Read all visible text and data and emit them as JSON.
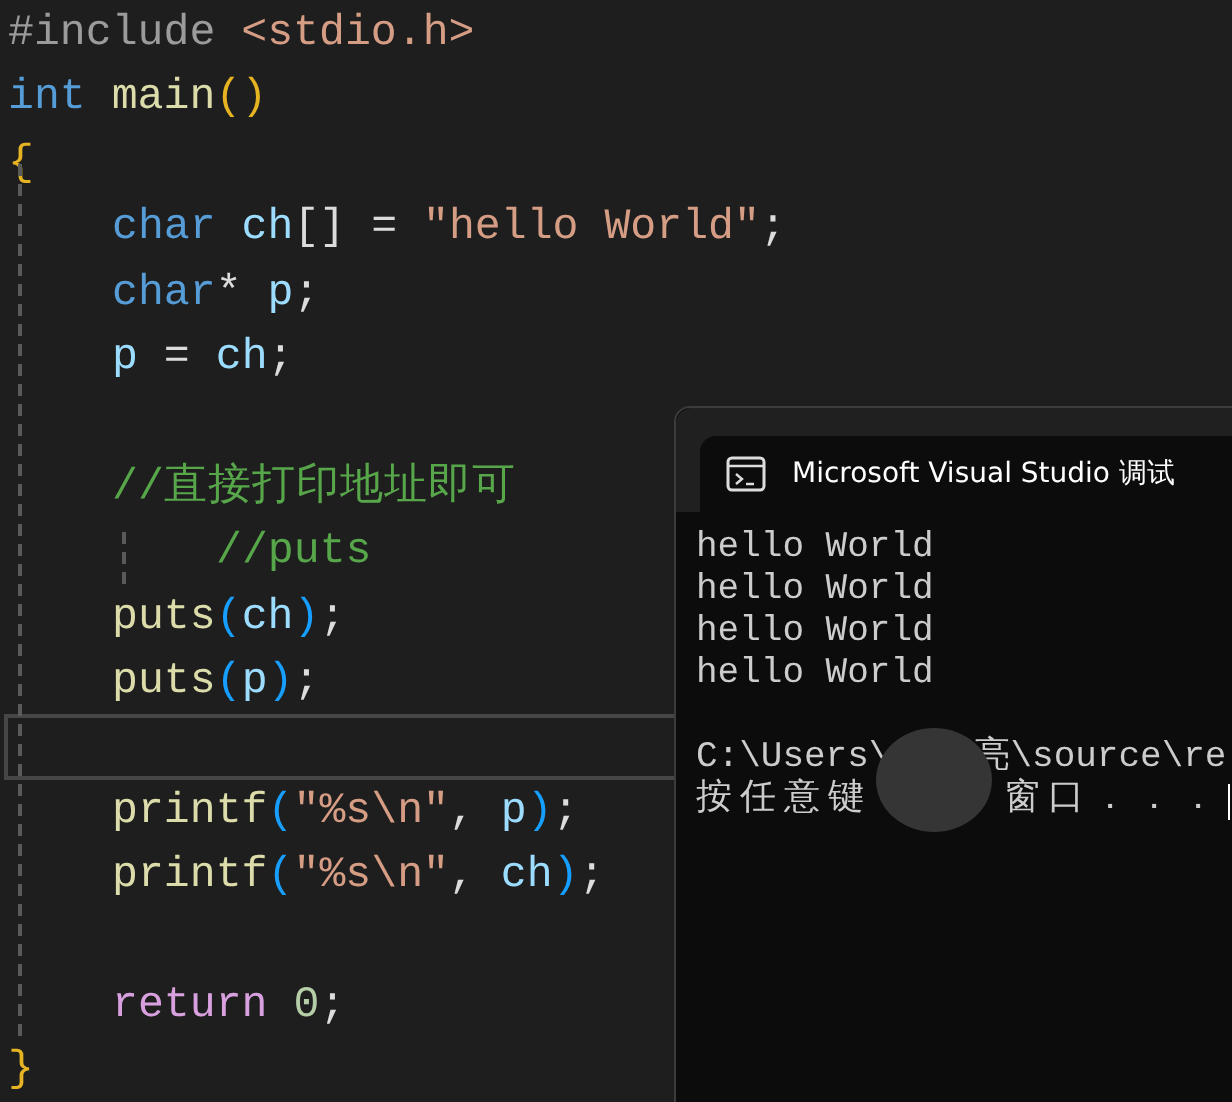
{
  "editor": {
    "lines": [
      {
        "current": false,
        "tokens": [
          {
            "kind": "preproc",
            "text": "#include "
          },
          {
            "kind": "include",
            "text": "<stdio.h>"
          }
        ]
      },
      {
        "current": false,
        "tokens": [
          {
            "kind": "keyword",
            "text": "int "
          },
          {
            "kind": "func",
            "text": "main"
          },
          {
            "kind": "brace",
            "text": "()"
          }
        ]
      },
      {
        "current": false,
        "tokens": [
          {
            "kind": "brace",
            "text": "{"
          }
        ],
        "children": [
          {
            "current": false,
            "tokens": [
              {
                "kind": "keyword",
                "text": "char "
              },
              {
                "kind": "var",
                "text": "ch"
              },
              {
                "kind": "plain",
                "text": "[] = "
              },
              {
                "kind": "string",
                "text": "\"hello World\""
              },
              {
                "kind": "plain",
                "text": ";"
              }
            ]
          },
          {
            "current": false,
            "tokens": [
              {
                "kind": "keyword",
                "text": "char"
              },
              {
                "kind": "plain",
                "text": "* "
              },
              {
                "kind": "var",
                "text": "p"
              },
              {
                "kind": "plain",
                "text": ";"
              }
            ]
          },
          {
            "current": false,
            "tokens": [
              {
                "kind": "var",
                "text": "p"
              },
              {
                "kind": "plain",
                "text": " = "
              },
              {
                "kind": "var",
                "text": "ch"
              },
              {
                "kind": "plain",
                "text": ";"
              }
            ]
          },
          {
            "current": false
          },
          {
            "current": false,
            "tokens": [
              {
                "kind": "comment",
                "text": "//直接打印地址即可"
              }
            ],
            "children": [
              {
                "current": false,
                "tokens": [
                  {
                    "kind": "comment",
                    "text": "//puts"
                  }
                ]
              }
            ]
          },
          {
            "current": false,
            "tokens": [
              {
                "kind": "func",
                "text": "puts"
              },
              {
                "kind": "paren",
                "text": "("
              },
              {
                "kind": "var",
                "text": "ch"
              },
              {
                "kind": "paren",
                "text": ")"
              },
              {
                "kind": "plain",
                "text": ";"
              }
            ]
          },
          {
            "current": false,
            "tokens": [
              {
                "kind": "func",
                "text": "puts"
              },
              {
                "kind": "paren",
                "text": "("
              },
              {
                "kind": "var",
                "text": "p"
              },
              {
                "kind": "paren",
                "text": ")"
              },
              {
                "kind": "plain",
                "text": ";"
              }
            ]
          },
          {
            "current": true
          },
          {
            "current": false,
            "tokens": [
              {
                "kind": "func",
                "text": "printf"
              },
              {
                "kind": "paren",
                "text": "("
              },
              {
                "kind": "string",
                "text": "\"%s\\n\""
              },
              {
                "kind": "plain",
                "text": ", "
              },
              {
                "kind": "var",
                "text": "p"
              },
              {
                "kind": "paren",
                "text": ")"
              },
              {
                "kind": "plain",
                "text": ";"
              }
            ]
          },
          {
            "current": false,
            "tokens": [
              {
                "kind": "func",
                "text": "printf"
              },
              {
                "kind": "paren",
                "text": "("
              },
              {
                "kind": "string",
                "text": "\"%s\\n\""
              },
              {
                "kind": "plain",
                "text": ", "
              },
              {
                "kind": "var",
                "text": "ch"
              },
              {
                "kind": "paren",
                "text": ")"
              },
              {
                "kind": "plain",
                "text": ";"
              }
            ]
          },
          {
            "current": false
          },
          {
            "current": false,
            "tokens": [
              {
                "kind": "control",
                "text": "return "
              },
              {
                "kind": "number",
                "text": "0"
              },
              {
                "kind": "plain",
                "text": ";"
              }
            ]
          }
        ]
      },
      {
        "current": false,
        "tokens": [
          {
            "kind": "brace",
            "text": "}"
          }
        ]
      }
    ]
  },
  "console": {
    "title": "Microsoft Visual Studio 调试",
    "output": [
      "hello World",
      "hello World",
      "hello World",
      "hello World"
    ],
    "path": {
      "before": "C:\\Users\\",
      "after": "亮\\source\\re"
    },
    "prompt": {
      "before": "按任意键",
      "after": "窗口．．．"
    }
  }
}
